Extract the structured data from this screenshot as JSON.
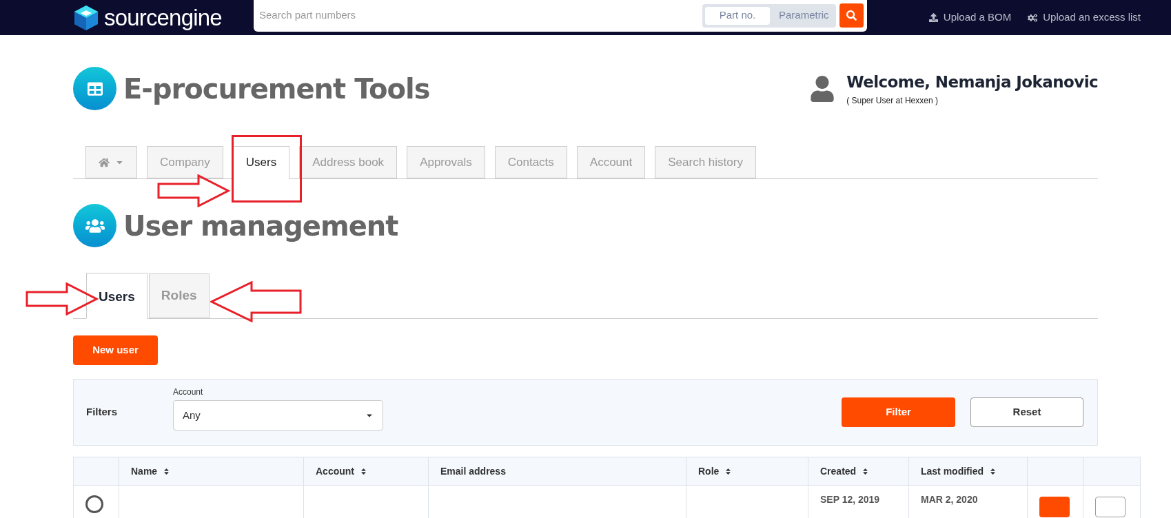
{
  "topbar": {
    "logo": "sourcengine",
    "search": {
      "placeholder": "Search part numbers"
    },
    "modes": [
      {
        "label": "Part no.",
        "selected": true
      },
      {
        "label": "Parametric",
        "selected": false
      }
    ],
    "links": [
      {
        "kind": "upload",
        "label": "Upload a BOM"
      },
      {
        "kind": "gears",
        "label": "Upload an excess list"
      }
    ]
  },
  "header": {
    "title": "E-procurement Tools",
    "welcome": "Welcome, Nemanja Jokanovic",
    "role": "( Super User at Hexxen )"
  },
  "nav_tabs": [
    {
      "kind": "home",
      "selected": false
    },
    {
      "kind": "text",
      "label": "Company",
      "selected": false
    },
    {
      "kind": "text",
      "label": "Users",
      "selected": true
    },
    {
      "kind": "text",
      "label": "Address book",
      "selected": false
    },
    {
      "kind": "text",
      "label": "Approvals",
      "selected": false
    },
    {
      "kind": "text",
      "label": "Contacts",
      "selected": false
    },
    {
      "kind": "text",
      "label": "Account",
      "selected": false
    },
    {
      "kind": "text",
      "label": "Search history",
      "selected": false
    }
  ],
  "section": {
    "title": "User management"
  },
  "sub_tabs": [
    {
      "label": "Users",
      "selected": true
    },
    {
      "label": "Roles",
      "selected": false
    }
  ],
  "new_user_button": "New user",
  "filters": {
    "title": "Filters",
    "account_label": "Account",
    "account_value": "Any",
    "filter_button": "Filter",
    "reset_button": "Reset"
  },
  "table": {
    "columns": [
      {
        "sortable": false
      },
      {
        "label": "Name",
        "sortable": true
      },
      {
        "label": "Account",
        "sortable": true
      },
      {
        "label": "Email address",
        "sortable": false
      },
      {
        "label": "Role",
        "sortable": true
      },
      {
        "label": "Created",
        "sortable": true
      },
      {
        "label": "Last modified",
        "sortable": true
      },
      {
        "sortable": false
      },
      {
        "sortable": false
      }
    ],
    "rows": [
      {
        "selected": false,
        "created": "SEP 12, 2019",
        "modified": "MAR 2, 2020"
      }
    ]
  }
}
